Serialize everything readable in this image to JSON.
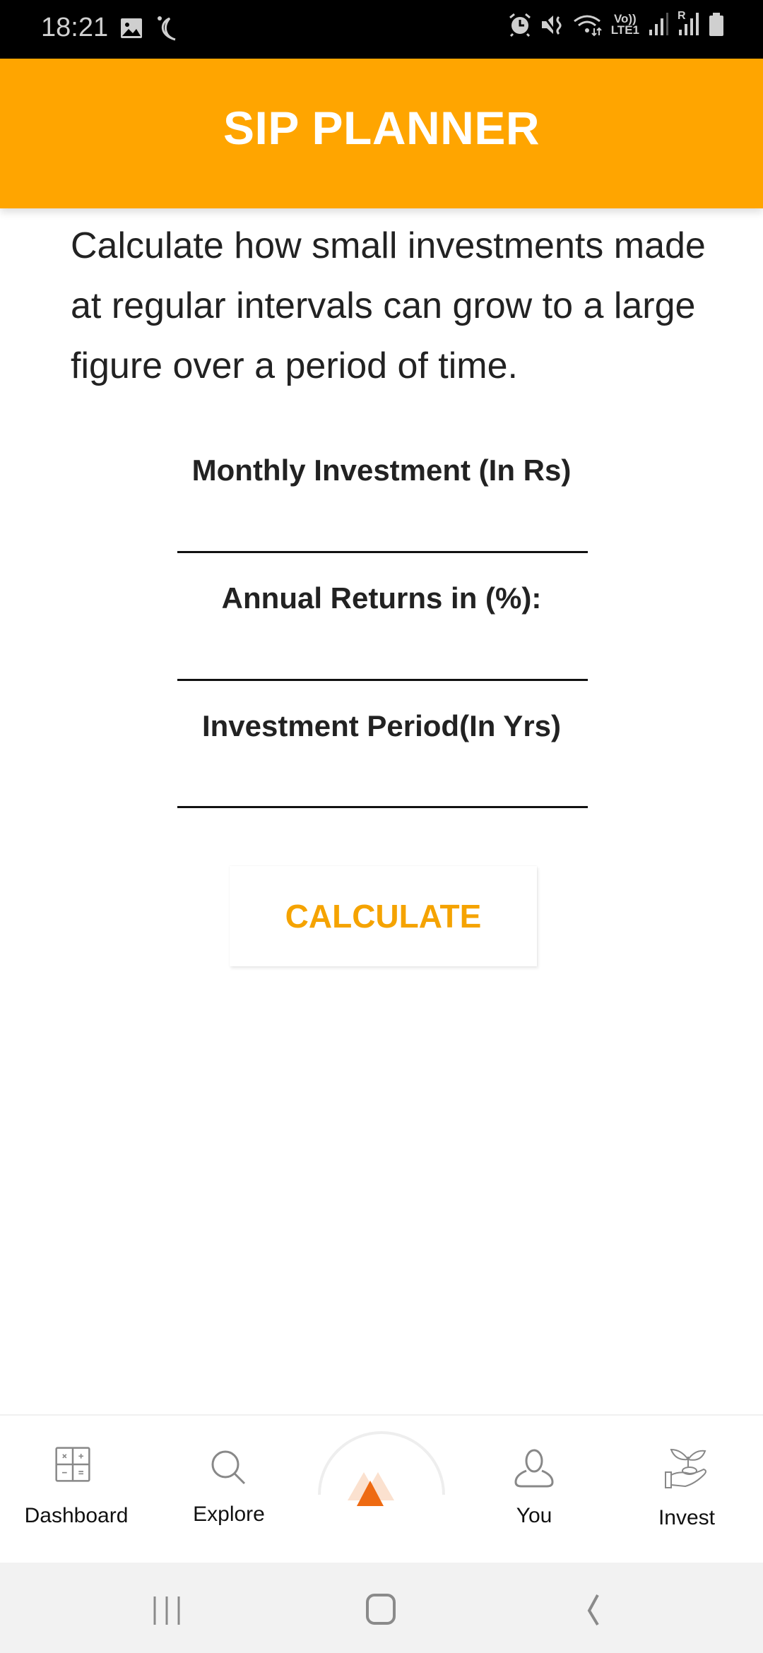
{
  "status_bar": {
    "time": "18:21",
    "left_icons": [
      "gallery-icon",
      "moon-icon"
    ],
    "right_icons": [
      "alarm-icon",
      "mute-icon",
      "wifi-icon",
      "volte-icon",
      "signal-icon",
      "roaming-signal-icon",
      "battery-icon"
    ],
    "volte_top": "Vo))",
    "volte_bottom": "LTE1",
    "roaming": "R"
  },
  "app_bar": {
    "title": "SIP PLANNER",
    "color": "#FFA500"
  },
  "description": "Calculate how small investments made at regular intervals can grow to a large figure over a period of time.",
  "form": {
    "fields": [
      {
        "label": "Monthly Investment (In Rs)",
        "value": "",
        "placeholder": ""
      },
      {
        "label": "Annual Returns in (%):",
        "value": "",
        "placeholder": ""
      },
      {
        "label": "Investment Period(In Yrs)",
        "value": "",
        "placeholder": ""
      }
    ],
    "calculate_label": "CALCULATE",
    "accent": "#F5A300"
  },
  "bottom_nav": {
    "items": [
      {
        "label": "Dashboard",
        "icon": "calculator-icon"
      },
      {
        "label": "Explore",
        "icon": "search-icon"
      },
      {
        "label": "",
        "icon": "home-logo-icon"
      },
      {
        "label": "You",
        "icon": "user-icon"
      },
      {
        "label": "Invest",
        "icon": "plant-hand-icon"
      }
    ]
  },
  "system_nav": [
    "recents-button",
    "home-button",
    "back-button"
  ]
}
